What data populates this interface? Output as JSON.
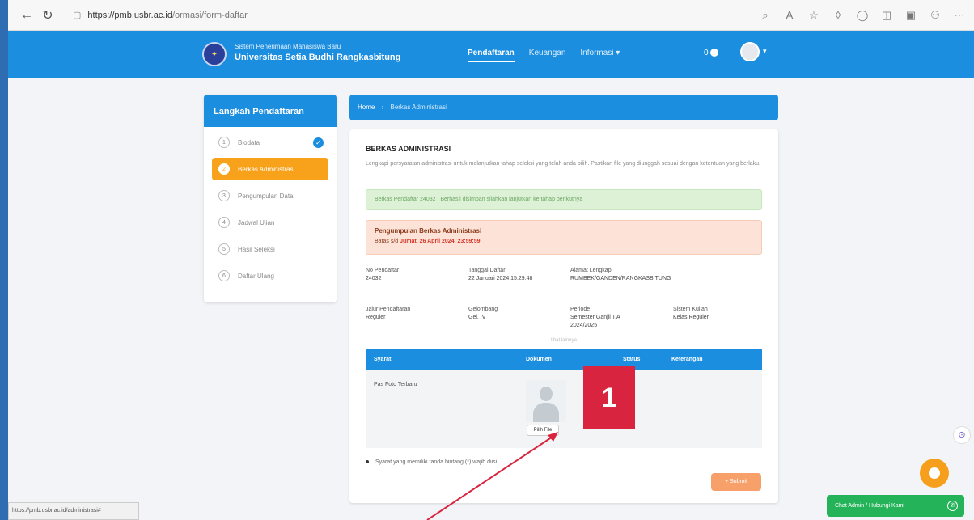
{
  "browser": {
    "url_host": "https://pmb.usbr.ac.id",
    "url_path": "/ormasi/form-daftar",
    "back_icon": "arrow-left-icon",
    "reload_icon": "reload-icon"
  },
  "header": {
    "subtitle": "Sistem Penerimaan Mahasiswa Baru",
    "title": "Universitas Setia Budhi Rangkasbitung",
    "nav": [
      "Pendaftaran",
      "Keuangan",
      "Informasi ▾"
    ],
    "notif_count": "0"
  },
  "sidebar": {
    "title": "Langkah Pendaftaran",
    "steps": [
      {
        "num": "1",
        "label": "Biodata"
      },
      {
        "num": "2",
        "label": "Berkas Administrasi"
      },
      {
        "num": "3",
        "label": "Pengumpulan Data"
      },
      {
        "num": "4",
        "label": "Jadwal Ujian"
      },
      {
        "num": "5",
        "label": "Hasil Seleksi"
      },
      {
        "num": "6",
        "label": "Daftar Ulang"
      }
    ]
  },
  "breadcrumb": {
    "home": "Home",
    "sep": "›",
    "current": "Berkas Administrasi"
  },
  "main": {
    "title": "BERKAS ADMINISTRASI",
    "description": "Lengkapi persyaratan administrasi untuk melanjutkan tahap seleksi yang telah anda pilih. Pastikan file yang diunggah sesuai dengan ketentuan yang berlaku.",
    "alert_success": "Berkas Pendaftar 24032 : Berhasil disimpan silahkan lanjutkan ke tahap berikutnya",
    "deadline": {
      "title": "Pengumpulan Berkas Administrasi",
      "prefix": "Batas s/d",
      "date": "Jumat, 26 April 2024, 23:59:59"
    },
    "info": {
      "no_label": "No Pendaftar",
      "no_value": "24032",
      "tgl_label": "Tanggal Daftar",
      "tgl_value": "22 Januari 2024 15:29:48",
      "mail_label": "Alamat Lengkap",
      "mail_value": "RUMBEK/GANDEN/RANGKASBITUNG",
      "jalur_label": "Jalur Pendaftaran",
      "jalur_value": "Reguler",
      "gelombang_label": "Gelombang",
      "gelombang_value": "Gel. IV",
      "periode_label": "Periode",
      "periode_value": "Semester Ganjil T.A 2024/2025",
      "sistem_label": "Sistem Kuliah",
      "sistem_value": "Kelas Reguler"
    },
    "more_link": "lihat lainnya",
    "table": {
      "headers": [
        "Syarat",
        "Dokumen",
        "Status",
        "Keterangan"
      ],
      "rows": [
        {
          "syarat": "Pas Foto Terbaru",
          "button": "Pilih File"
        }
      ]
    },
    "note": "Syarat yang memiliki tanda bintang (*) wajib diisi",
    "submit": "+ Submit"
  },
  "overlay": {
    "step_badge": "1",
    "status_url": "https://pmb.usbr.ac.id/administrasi#",
    "wa_label": "Chat Admin / Hubungi Kami"
  }
}
